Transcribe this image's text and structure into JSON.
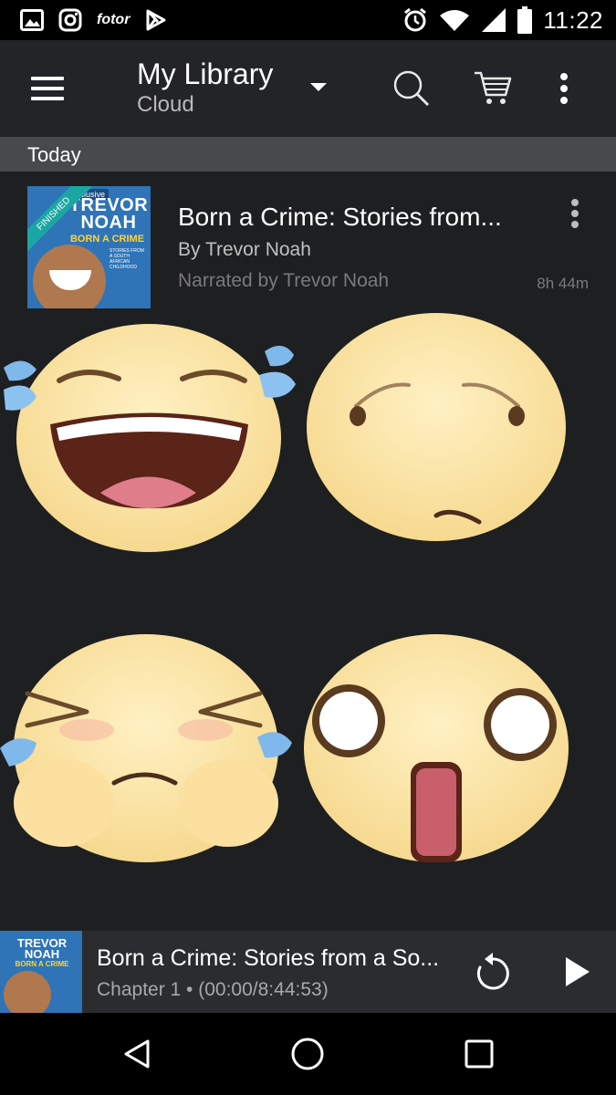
{
  "status_bar": {
    "notif_app_label": "fotor",
    "time": "11:22",
    "icons": [
      "image-icon",
      "instagram-icon",
      "fotor-icon",
      "play-store-icon",
      "alarm-icon",
      "wifi-icon",
      "signal-icon",
      "battery-icon"
    ]
  },
  "app_bar": {
    "title": "My Library",
    "subtitle": "Cloud",
    "icons": [
      "menu-icon",
      "dropdown-caret-icon",
      "search-icon",
      "cart-icon",
      "overflow-menu-icon"
    ]
  },
  "section_header": "Today",
  "book": {
    "title": "Born a Crime: Stories from...",
    "author": "By Trevor Noah",
    "narrator": "Narrated by Trevor Noah",
    "length": "8h 44m",
    "cover": {
      "badge": "exclusive",
      "name_line1": "TREVOR",
      "name_line2": "NOAH",
      "title": "BORN A CRIME",
      "tagline": "STORIES FROM A SOUTH AFRICAN CHILDHOOD",
      "ribbon": "FINISHED"
    }
  },
  "emojis": [
    "laughing-tears",
    "worried-sad",
    "crying-squint",
    "shocked"
  ],
  "player": {
    "title": "Born a Crime: Stories from a So...",
    "chapter": "Chapter 1 • (00:00/8:44:53)",
    "cover_name_line1": "TREVOR",
    "cover_name_line2": "NOAH",
    "cover_title": "BORN A CRIME"
  },
  "nav_bar": {
    "icons": [
      "back-icon",
      "home-icon",
      "recents-icon"
    ]
  },
  "colors": {
    "background": "#1e1f21",
    "app_bar": "#232427",
    "section": "#48494c",
    "emoji_face": "#fde8a6",
    "tear": "#7fb8ea",
    "cover_blue": "#2e74b7",
    "ribbon_teal": "#1aa7a3"
  }
}
